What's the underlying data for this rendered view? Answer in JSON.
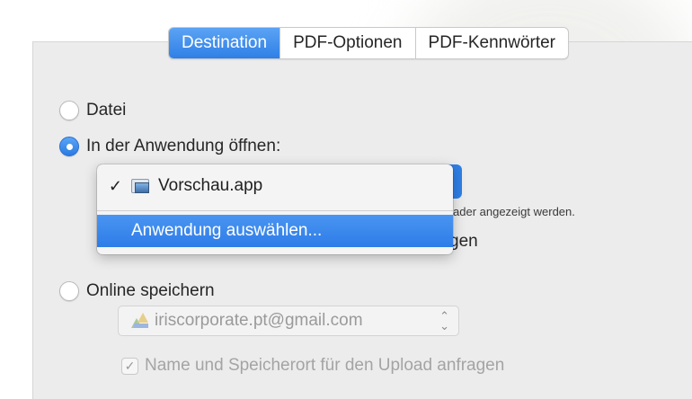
{
  "tabs": [
    {
      "label": "Destination",
      "active": true
    },
    {
      "label": "PDF-Optionen",
      "active": false
    },
    {
      "label": "PDF-Kennwörter",
      "active": false
    }
  ],
  "options": {
    "file": {
      "label": "Datei",
      "selected": false
    },
    "open_in_app": {
      "label": "In der Anwendung öffnen:",
      "selected": true
    },
    "online": {
      "label": "Online speichern",
      "selected": false
    }
  },
  "app_menu": {
    "check": "✓",
    "current_app": "Vorschau.app",
    "choose_label": "Anwendung auswählen..."
  },
  "hint_text": "ader angezeigt werden.",
  "hidden_text": "gen",
  "account": {
    "email": "iriscorporate.pt@gmail.com",
    "arrows": "⌃⌄"
  },
  "upload_checkbox": {
    "label": "Name und Speicherort für den Upload anfragen",
    "check": "✓",
    "checked": true
  },
  "colors": {
    "accent": "#2f7fe6",
    "panel": "#ececec"
  }
}
